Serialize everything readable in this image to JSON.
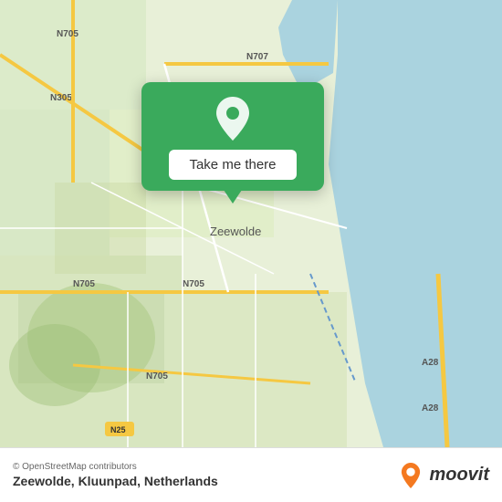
{
  "map": {
    "alt": "Map of Zeewolde area, Netherlands"
  },
  "popup": {
    "button_label": "Take me there",
    "pin_alt": "location pin"
  },
  "bottom_bar": {
    "copyright": "© OpenStreetMap contributors",
    "location": "Zeewolde, Kluunpad, Netherlands",
    "brand": "moovit"
  },
  "colors": {
    "popup_green": "#3aaa5c",
    "map_land": "#e8f0d8",
    "map_water": "#aad3df",
    "road_primary": "#f5c842",
    "road_secondary": "#ffffff"
  }
}
